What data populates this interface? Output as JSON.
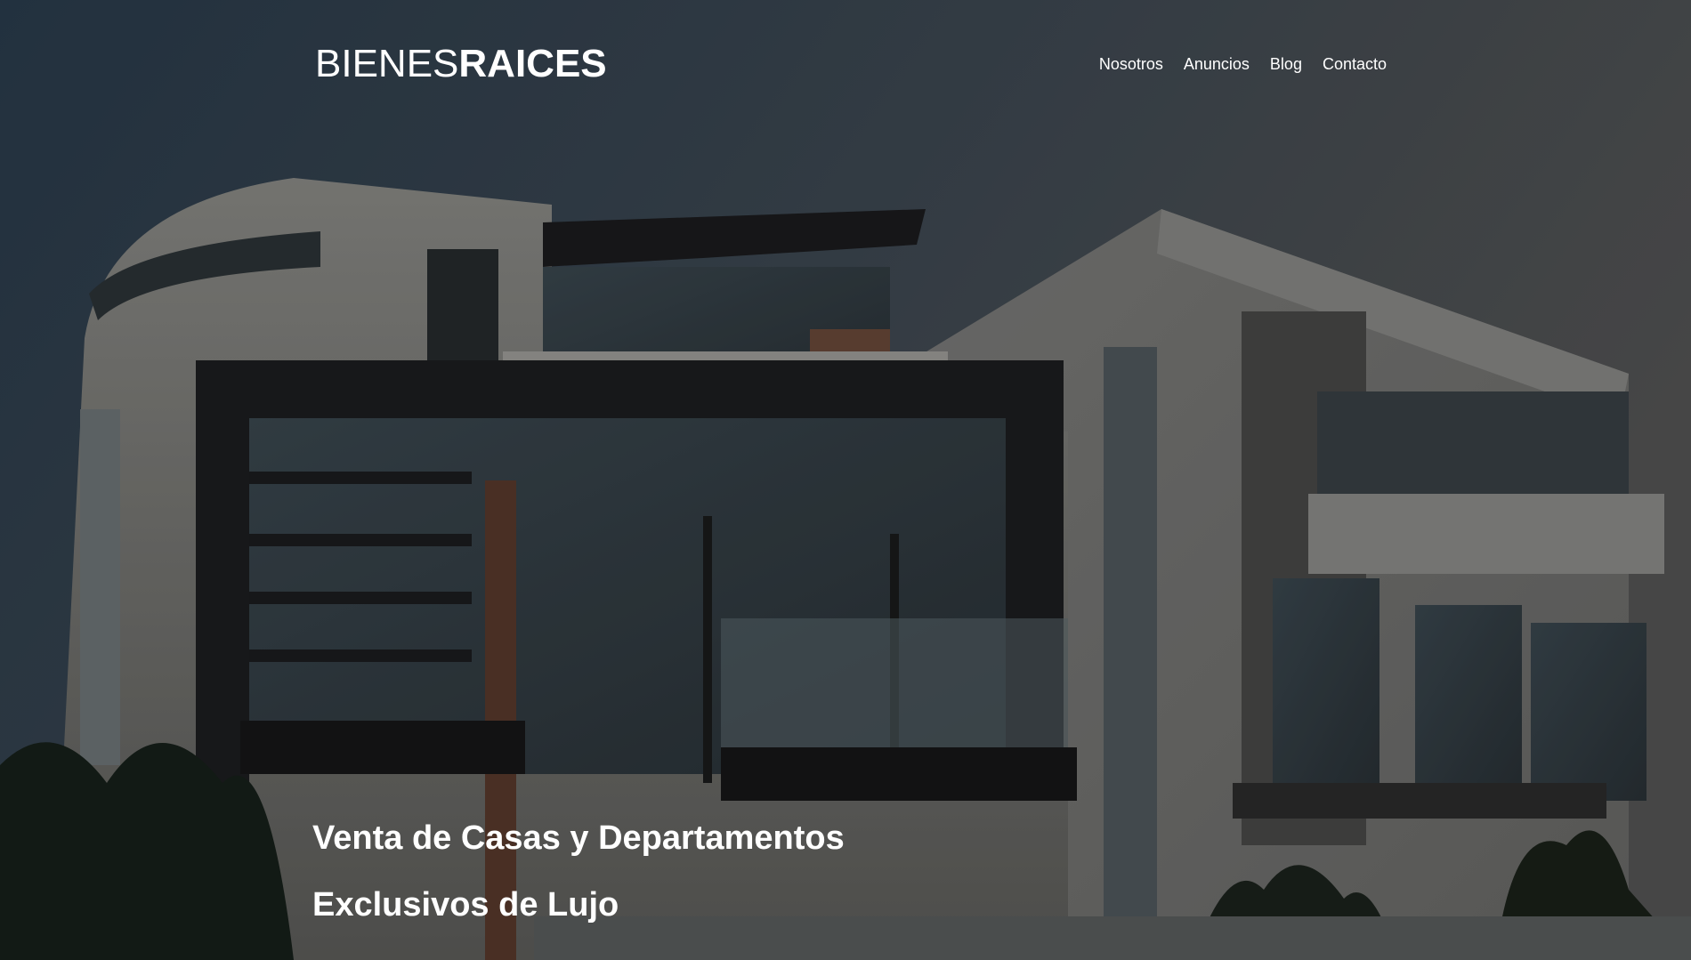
{
  "brand": {
    "light": "BIENES",
    "bold": "RAICES"
  },
  "nav": {
    "items": [
      {
        "label": "Nosotros"
      },
      {
        "label": "Anuncios"
      },
      {
        "label": "Blog"
      },
      {
        "label": "Contacto"
      }
    ]
  },
  "hero": {
    "line1": "Venta de Casas y Departamentos",
    "line2": "Exclusivos de Lujo"
  },
  "colors": {
    "text": "#ffffff",
    "overlay": "#000000"
  }
}
